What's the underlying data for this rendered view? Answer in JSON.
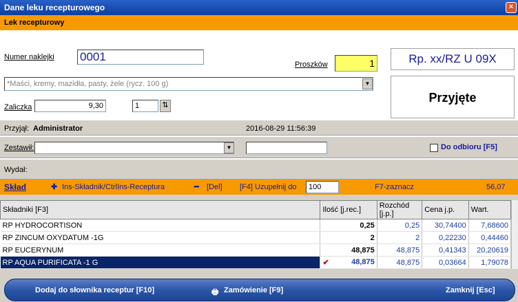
{
  "window": {
    "title": "Dane leku recepturowego",
    "close_label": "×"
  },
  "header": {
    "section_title": "Lek recepturowy"
  },
  "form": {
    "numer_label": "Numer naklejki",
    "numer_value": "0001",
    "proszkow_label": "Proszków",
    "proszkow_value": "1",
    "category_value": "*Maści, kremy, mazidła, pasty, żele (rycz. 100 g)",
    "zaliczka_label": "Zaliczka",
    "zaliczka_value": "9,30",
    "count_value": "1",
    "przyjal_label": "Przyjął:",
    "przyjal_value": "Administrator",
    "przyjal_date": "2016-08-29 11:56:39",
    "zestawil_label": "Zestawił:",
    "do_odbioru_label": "Do odbioru [F5]",
    "wydal_label": "Wydał:"
  },
  "right_panel": {
    "rp_code": "Rp. xx/RZ U 09X",
    "status": "Przyjęte"
  },
  "toolbar": {
    "sklad_label": "Skład",
    "add_label": "Ins-Składnik/CtrlIns-Receptura",
    "del_label": "[Del]",
    "fill_label": "[F4] Uzupełnij do",
    "fill_value": "100",
    "select_label": "F7-zaznacz",
    "total_value": "56,07"
  },
  "table": {
    "columns": [
      "Składniki [F3]",
      "Ilość [j.rec.]",
      "Rozchód [j.p.]",
      "Cena j.p.",
      "Wart."
    ],
    "rows": [
      {
        "name": "RP HYDROCORTISON",
        "qty": "0,25",
        "rozchod": "0,25",
        "cena": "30,74400",
        "wart": "7,68600"
      },
      {
        "name": "RP ZINCUM OXYDATUM -1G",
        "qty": "2",
        "rozchod": "2",
        "cena": "0,22230",
        "wart": "0,44460"
      },
      {
        "name": "RP EUCERYNUM",
        "qty": "48,875",
        "rozchod": "48,875",
        "cena": "0,41343",
        "wart": "20,20619"
      },
      {
        "name": "RP AQUA PURIFICATA -1 G",
        "qty": "48,875",
        "rozchod": "48,875",
        "cena": "0,03664",
        "wart": "1,79078"
      }
    ]
  },
  "footer": {
    "add_dict_label": "Dodaj do słownika receptur [F10]",
    "order_label": "Zamówienie [F9]",
    "close_label": "Zamknij [Esc]"
  },
  "colors": {
    "accent_orange": "#f79a00",
    "title_blue": "#1a4fb4",
    "selection": "#0a246a"
  }
}
